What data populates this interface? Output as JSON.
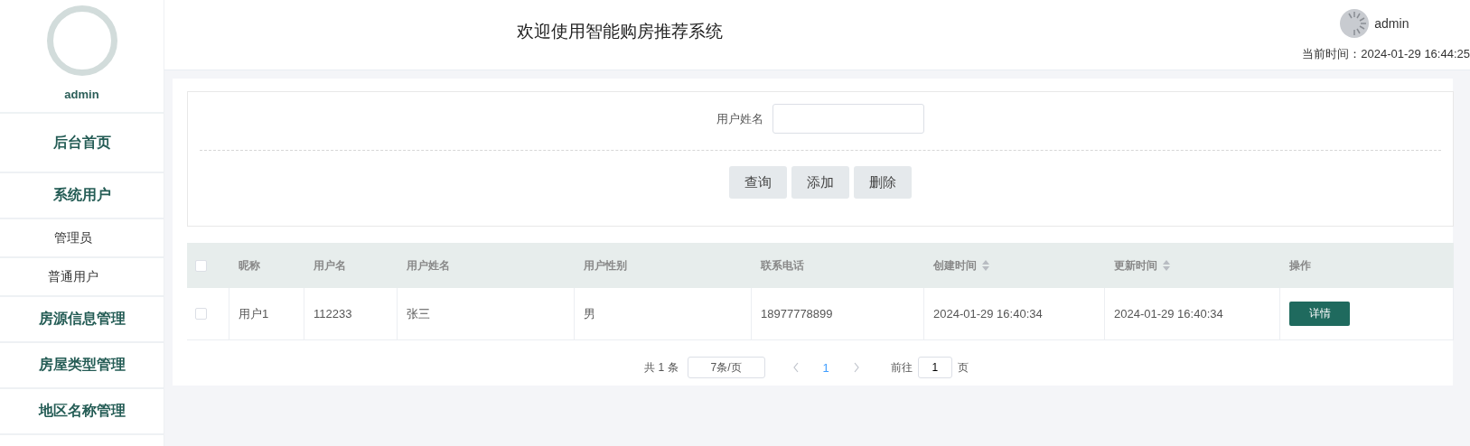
{
  "sidebar": {
    "user": "admin",
    "items": [
      {
        "label": "后台首页"
      },
      {
        "label": "系统用户",
        "children": [
          {
            "label": "管理员"
          },
          {
            "label": "普通用户"
          }
        ]
      },
      {
        "label": "房源信息管理"
      },
      {
        "label": "房屋类型管理"
      },
      {
        "label": "地区名称管理"
      }
    ]
  },
  "header": {
    "title": "欢迎使用智能购房推荐系统",
    "user": "admin",
    "time": "当前时间：2024-01-29 16:44:25"
  },
  "search": {
    "label": "用户姓名",
    "buttons": [
      "查询",
      "添加",
      "删除"
    ]
  },
  "table": {
    "all_checked": false,
    "columns": [
      {
        "label": "昵称",
        "sortable": false
      },
      {
        "label": "用户名",
        "sortable": false
      },
      {
        "label": "用户姓名",
        "sortable": false
      },
      {
        "label": "用户性别",
        "sortable": false
      },
      {
        "label": "联系电话",
        "sortable": false
      },
      {
        "label": "创建时间",
        "sortable": true
      },
      {
        "label": "更新时间",
        "sortable": true
      },
      {
        "label": "操作",
        "sortable": false
      }
    ],
    "rows": [
      {
        "checked": false,
        "cells": [
          "用户1",
          "112233",
          "张三",
          "男",
          "18977778899",
          "2024-01-29 16:40:34",
          "2024-01-29 16:40:34"
        ],
        "action": "详情"
      }
    ]
  },
  "pagination": {
    "total": "共 1 条",
    "page_size": "7条/页",
    "pages": [
      {
        "label": "1",
        "selected": true
      }
    ],
    "goto_label": "前往",
    "goto_value": "1",
    "goto_unit": "页"
  }
}
